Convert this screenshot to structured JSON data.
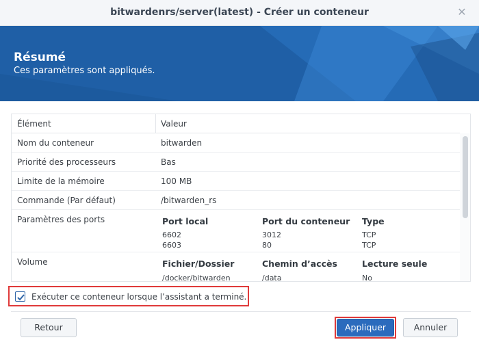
{
  "window": {
    "title": "bitwardenrs/server(latest) - Créer un conteneur",
    "close_icon": "close-icon"
  },
  "banner": {
    "title": "Résumé",
    "subtitle": "Ces paramètres sont appliqués.",
    "color": "#1f5fa6"
  },
  "table": {
    "headers": {
      "key": "Élément",
      "value": "Valeur"
    },
    "rows": [
      {
        "key": "Nom du conteneur",
        "value": "bitwarden"
      },
      {
        "key": "Priorité des processeurs",
        "value": "Bas"
      },
      {
        "key": "Limite de la mémoire",
        "value": "100 MB"
      },
      {
        "key": "Commande (Par défaut)",
        "value": "/bitwarden_rs"
      }
    ],
    "ports": {
      "key": "Paramètres des ports",
      "headers": [
        "Port local",
        "Port du conteneur",
        "Type"
      ],
      "rows": [
        [
          "6602",
          "3012",
          "TCP"
        ],
        [
          "6603",
          "80",
          "TCP"
        ]
      ]
    },
    "volume": {
      "key": "Volume",
      "headers": [
        "Fichier/Dossier",
        "Chemin d’accès",
        "Lecture seule"
      ],
      "rows": [
        [
          "/docker/bitwarden",
          "/data",
          "No"
        ]
      ]
    }
  },
  "run_after": {
    "checked": true,
    "label": "Exécuter ce conteneur lorsque l’assistant a terminé."
  },
  "footer": {
    "back_label": "Retour",
    "apply_label": "Appliquer",
    "cancel_label": "Annuler"
  },
  "colors": {
    "primary": "#2b6bbd",
    "highlight": "#e03a3a"
  }
}
